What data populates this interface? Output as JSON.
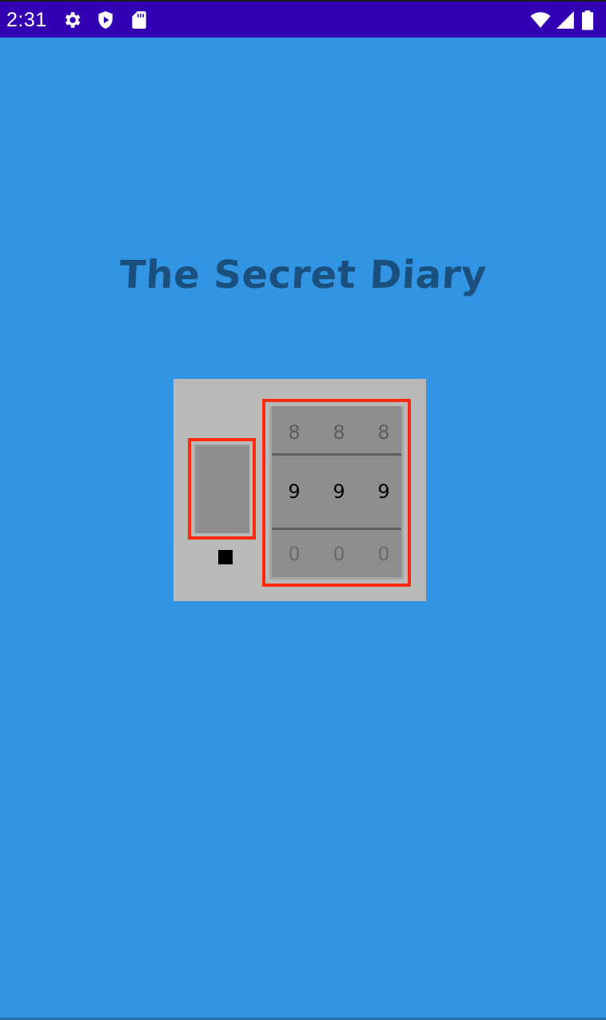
{
  "status_bar": {
    "time": "2:31",
    "background": "#3300b3",
    "icons_left": [
      "gear-icon",
      "play-protect-icon",
      "sd-card-icon"
    ],
    "icons_right": [
      "wifi-icon",
      "signal-icon",
      "battery-icon"
    ]
  },
  "app": {
    "title": "The Secret Diary",
    "title_color": "#1a4f7e",
    "background": "#3195e4"
  },
  "lock": {
    "panel_color": "#b9b9b9",
    "highlight_color": "#ff2a0b",
    "dial": {
      "above": [
        "8",
        "8",
        "8"
      ],
      "selected": [
        "9",
        "9",
        "9"
      ],
      "below": [
        "0",
        "0",
        "0"
      ]
    }
  }
}
